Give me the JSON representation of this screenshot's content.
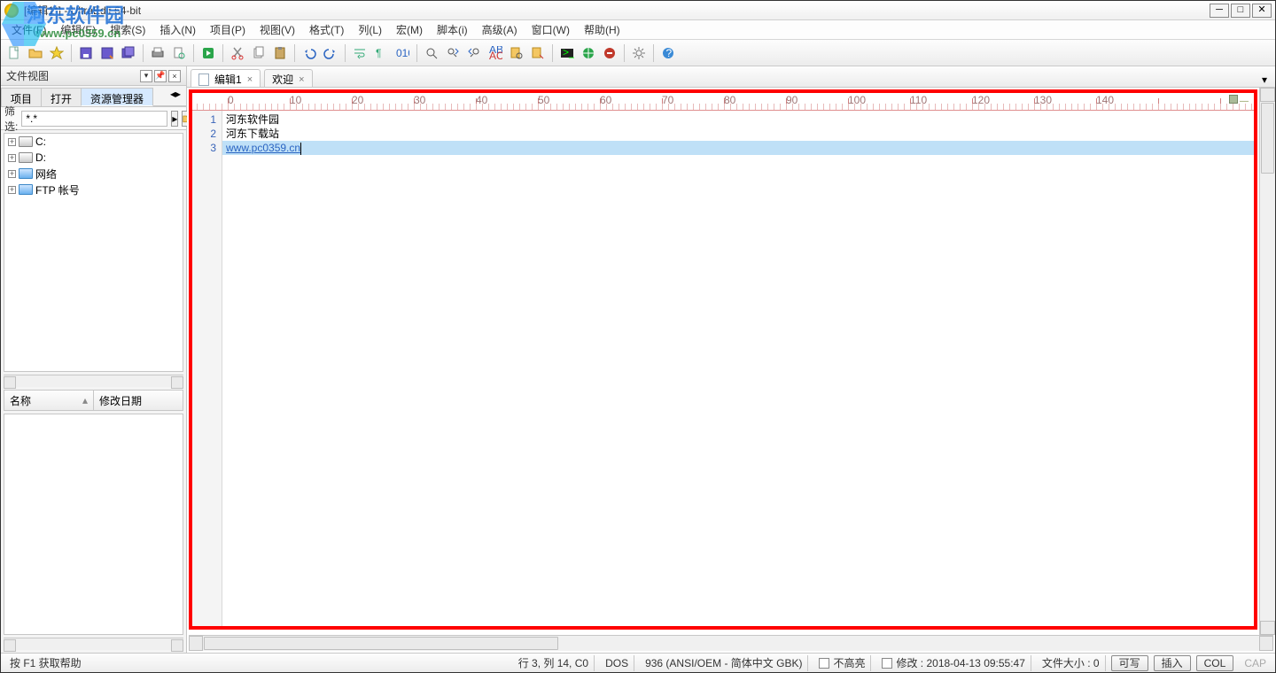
{
  "title": "[编辑1*] - UltraEdit 64-bit",
  "watermark": {
    "line1": "河东软件园",
    "line2": "www.pc0359.cn"
  },
  "menus": [
    "文件(F)",
    "编辑(E)",
    "搜索(S)",
    "插入(N)",
    "项目(P)",
    "视图(V)",
    "格式(T)",
    "列(L)",
    "宏(M)",
    "脚本(i)",
    "高级(A)",
    "窗口(W)",
    "帮助(H)"
  ],
  "side": {
    "panel_title": "文件视图",
    "tabs": [
      "项目",
      "打开",
      "资源管理器"
    ],
    "active_tab_index": 2,
    "filter_label": "筛选:",
    "filter_value": "*.*",
    "tree": [
      {
        "label": "C:",
        "icon": "drive"
      },
      {
        "label": "D:",
        "icon": "drive"
      },
      {
        "label": "网络",
        "icon": "folder"
      },
      {
        "label": "FTP 帐号",
        "icon": "folder"
      }
    ],
    "columns": [
      "名称",
      "修改日期"
    ]
  },
  "tabs": [
    {
      "label": "编辑1",
      "active": true
    },
    {
      "label": "欢迎",
      "active": false
    }
  ],
  "ruler_labels": [
    "0",
    "10",
    "20",
    "30",
    "40",
    "50",
    "60",
    "70",
    "80",
    "90",
    "100",
    "110",
    "120",
    "130",
    "140"
  ],
  "editor": {
    "lines": [
      {
        "n": 1,
        "text": "河东软件园",
        "hl": false,
        "url": false
      },
      {
        "n": 2,
        "text": "河东下载站",
        "hl": false,
        "url": false
      },
      {
        "n": 3,
        "text": "www.pc0359.cn",
        "hl": true,
        "url": true
      }
    ]
  },
  "status": {
    "help": "按 F1 获取帮助",
    "pos": "行 3, 列 14, C0",
    "eol": "DOS",
    "enc": "936  (ANSI/OEM - 简体中文 GBK)",
    "hl_none": "不高亮",
    "mod": "修改 :  2018-04-13 09:55:47",
    "size": "文件大小 :  0",
    "rw": "可写",
    "ins": "插入",
    "col": "COL",
    "cap": "CAP"
  }
}
